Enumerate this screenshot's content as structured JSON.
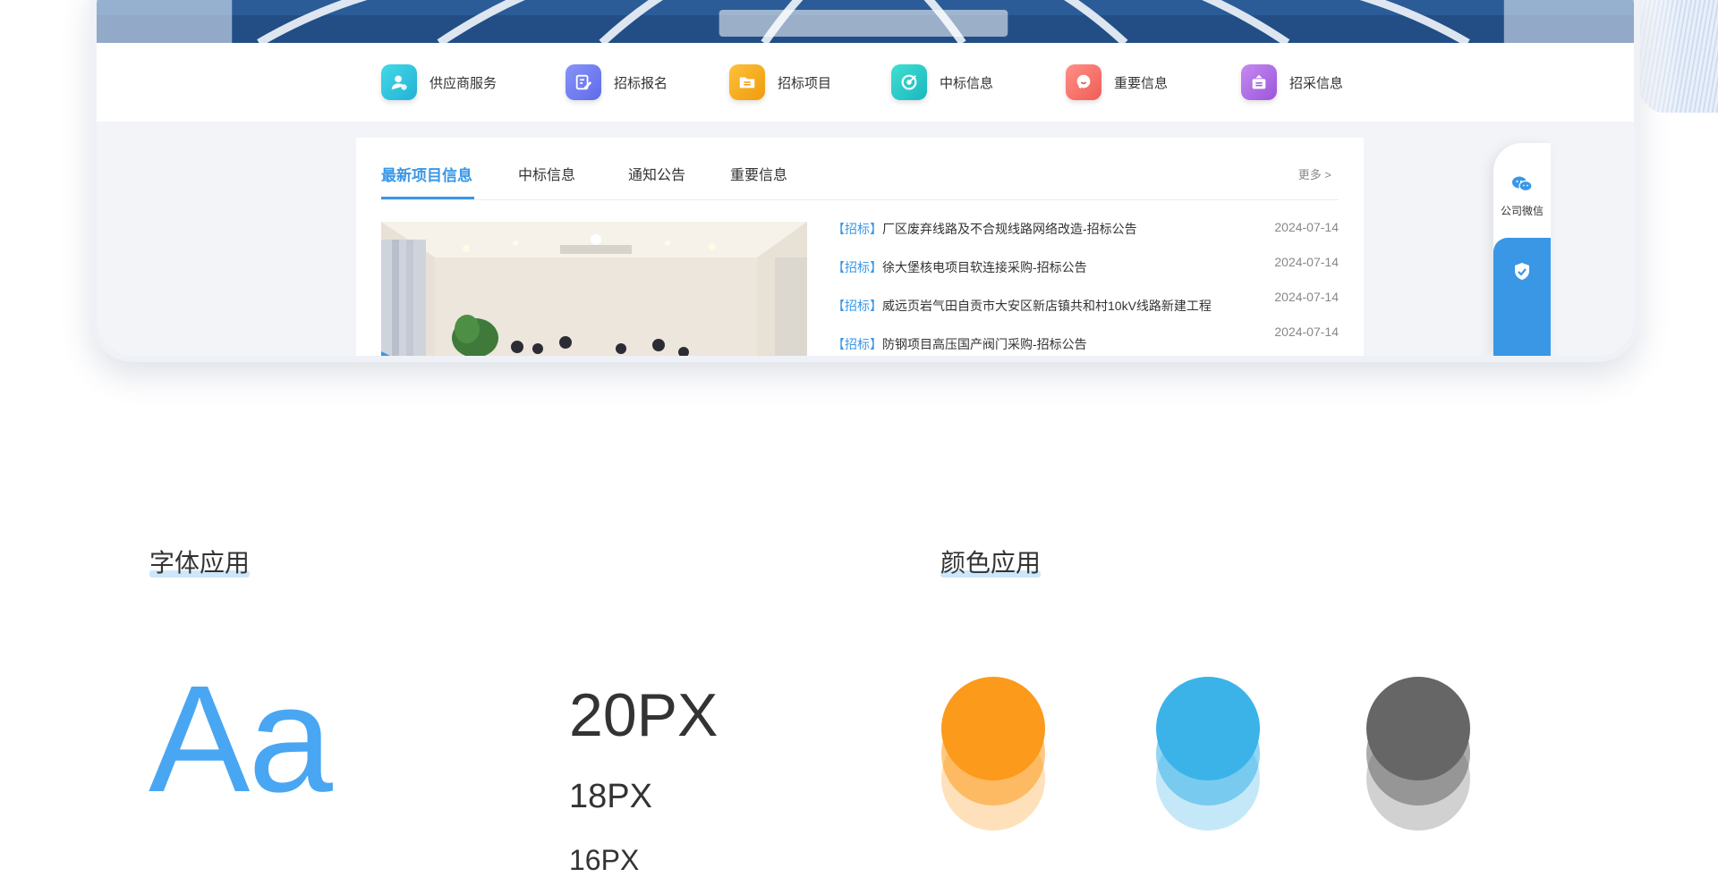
{
  "quick_nav": [
    {
      "label": "供应商服务",
      "icon": "supplier-user-icon",
      "color": "#2cc3d9"
    },
    {
      "label": "招标报名",
      "icon": "signup-edit-icon",
      "color": "#6a78f0"
    },
    {
      "label": "招标项目",
      "icon": "project-folder-icon",
      "color": "#f4a81a"
    },
    {
      "label": "中标信息",
      "icon": "winning-target-icon",
      "color": "#27c6c2"
    },
    {
      "label": "重要信息",
      "icon": "important-chat-icon",
      "color": "#f2736c"
    },
    {
      "label": "招采信息",
      "icon": "procurement-box-icon",
      "color": "#b06ae2"
    }
  ],
  "tabs": [
    {
      "label": "最新项目信息",
      "active": true
    },
    {
      "label": "中标信息",
      "active": false
    },
    {
      "label": "通知公告",
      "active": false
    },
    {
      "label": "重要信息",
      "active": false
    }
  ],
  "more_label": "更多 >",
  "news": [
    {
      "tag": "【招标】",
      "title": "厂区废弃线路及不合规线路网络改造-招标公告",
      "date": "2024-07-14"
    },
    {
      "tag": "【招标】",
      "title": "徐大堡核电项目软连接采购-招标公告",
      "date": "2024-07-14"
    },
    {
      "tag": "【招标】",
      "title": "威远页岩气田自贡市大安区新店镇共和村10kV线路新建工程",
      "date": "2024-07-14"
    },
    {
      "tag": "【招标】",
      "title": "防钢项目高压国产阀门采购-招标公告",
      "date": "2024-07-14"
    }
  ],
  "side_float": {
    "wechat_label": "公司微信"
  },
  "font_section": {
    "title": "字体应用",
    "sample": "Aa",
    "sizes": [
      "20PX",
      "18PX",
      "16PX"
    ],
    "sample_color": "#49a6f2"
  },
  "color_section": {
    "title": "颜色应用",
    "colors": [
      "#fb9a1b",
      "#3bb3e8",
      "#666666"
    ]
  }
}
